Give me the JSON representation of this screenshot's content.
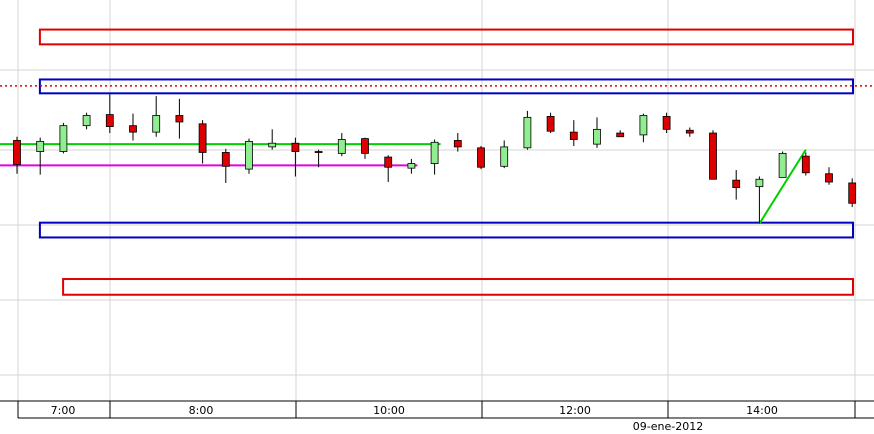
{
  "chart_data": {
    "type": "candlestick",
    "x_tick_labels": [
      "7:00",
      "8:00",
      "10:00",
      "12:00",
      "14:00"
    ],
    "date_label": "09-ene-2012",
    "ylim": [
      0,
      434
    ],
    "candles": [
      {
        "t": 0,
        "o": 282,
        "c": 256,
        "h": 286,
        "l": 246
      },
      {
        "t": 1,
        "o": 270,
        "c": 281,
        "h": 285,
        "l": 245
      },
      {
        "t": 2,
        "o": 270,
        "c": 298,
        "h": 301,
        "l": 268
      },
      {
        "t": 3,
        "o": 298,
        "c": 309,
        "h": 312,
        "l": 294
      },
      {
        "t": 4,
        "o": 310,
        "c": 297,
        "h": 332,
        "l": 290
      },
      {
        "t": 5,
        "o": 298,
        "c": 291,
        "h": 311,
        "l": 282
      },
      {
        "t": 6,
        "o": 291,
        "c": 309,
        "h": 330,
        "l": 286
      },
      {
        "t": 7,
        "o": 309,
        "c": 302,
        "h": 327,
        "l": 284
      },
      {
        "t": 8,
        "o": 300,
        "c": 269,
        "h": 304,
        "l": 257
      },
      {
        "t": 9,
        "o": 269,
        "c": 254,
        "h": 273,
        "l": 236
      },
      {
        "t": 10,
        "o": 251,
        "c": 281,
        "h": 284,
        "l": 246
      },
      {
        "t": 11,
        "o": 275,
        "c": 279,
        "h": 294,
        "l": 272
      },
      {
        "t": 12,
        "o": 279,
        "c": 270,
        "h": 285,
        "l": 243
      },
      {
        "t": 13,
        "o": 270,
        "c": 269,
        "h": 272,
        "l": 253
      },
      {
        "t": 14,
        "o": 268,
        "c": 283,
        "h": 290,
        "l": 265
      },
      {
        "t": 15,
        "o": 284,
        "c": 268,
        "h": 285,
        "l": 262
      },
      {
        "t": 16,
        "o": 264,
        "c": 253,
        "h": 266,
        "l": 237
      },
      {
        "t": 17,
        "o": 252,
        "c": 257,
        "h": 262,
        "l": 246
      },
      {
        "t": 18,
        "o": 257,
        "c": 280,
        "h": 283,
        "l": 245
      },
      {
        "t": 19,
        "o": 282,
        "c": 275,
        "h": 290,
        "l": 270
      },
      {
        "t": 20,
        "o": 274,
        "c": 253,
        "h": 276,
        "l": 251
      },
      {
        "t": 21,
        "o": 254,
        "c": 275,
        "h": 282,
        "l": 252
      },
      {
        "t": 22,
        "o": 274,
        "c": 307,
        "h": 314,
        "l": 272
      },
      {
        "t": 23,
        "o": 308,
        "c": 292,
        "h": 312,
        "l": 290
      },
      {
        "t": 24,
        "o": 291,
        "c": 283,
        "h": 304,
        "l": 276
      },
      {
        "t": 25,
        "o": 278,
        "c": 294,
        "h": 307,
        "l": 274
      },
      {
        "t": 26,
        "o": 290,
        "c": 286,
        "h": 293,
        "l": 286
      },
      {
        "t": 27,
        "o": 288,
        "c": 309,
        "h": 311,
        "l": 280
      },
      {
        "t": 28,
        "o": 308,
        "c": 294,
        "h": 312,
        "l": 290
      },
      {
        "t": 29,
        "o": 293,
        "c": 290,
        "h": 296,
        "l": 286
      },
      {
        "t": 30,
        "o": 290,
        "c": 240,
        "h": 293,
        "l": 240
      },
      {
        "t": 31,
        "o": 239,
        "c": 231,
        "h": 250,
        "l": 218
      },
      {
        "t": 32,
        "o": 232,
        "c": 240,
        "h": 243,
        "l": 192
      },
      {
        "t": 33,
        "o": 242,
        "c": 268,
        "h": 270,
        "l": 242
      },
      {
        "t": 34,
        "o": 265,
        "c": 247,
        "h": 269,
        "l": 244
      },
      {
        "t": 35,
        "o": 246,
        "c": 237,
        "h": 253,
        "l": 234
      },
      {
        "t": 36,
        "o": 236,
        "c": 214,
        "h": 241,
        "l": 210
      }
    ],
    "annotations": {
      "boxes": [
        {
          "color": "#e00000",
          "price_top": 402,
          "price_bottom": 386,
          "t_start": 1,
          "t_end": 36
        },
        {
          "color": "#0000c0",
          "price_top": 348,
          "price_bottom": 333,
          "t_start": 1,
          "t_end": 36
        },
        {
          "color": "#0000c0",
          "price_top": 193,
          "price_bottom": 177,
          "t_start": 1,
          "t_end": 36
        },
        {
          "color": "#e00000",
          "price_top": 132,
          "price_bottom": 115,
          "t_start": 2,
          "t_end": 36
        }
      ],
      "hlines": [
        {
          "color": "#e00000",
          "price": 341,
          "dash": true,
          "t_start": 0,
          "t_end": 38
        },
        {
          "color": "#00d000",
          "price": 278,
          "t_start": 0,
          "t_end": 18
        },
        {
          "color": "#e000e0",
          "price": 255,
          "t_start": 0,
          "t_end": 17
        }
      ],
      "trendlines": [
        {
          "color": "#00d000",
          "t1": 32.0,
          "p1": 192,
          "t2": 34.0,
          "p2": 272
        }
      ]
    },
    "colors": {
      "up": "#90ee90",
      "down": "#dd0000",
      "grid": "#d4d4d4"
    }
  }
}
